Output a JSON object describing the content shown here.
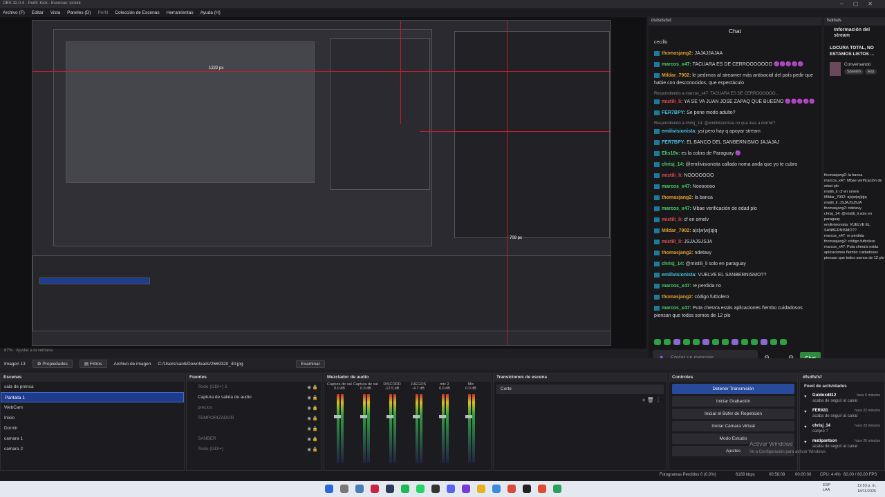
{
  "window": {
    "title": "OBS 32.0.4 - Perfil: Kick - Escenas: sickkk"
  },
  "menu": [
    "Archivo (F)",
    "Editar",
    "Vista",
    "Paneles (D)",
    "Perfil",
    "Colección de Escenas",
    "Herramientas",
    "Ayuda (H)"
  ],
  "preview": {
    "zoom": "87%",
    "fit": "Ajustar a la ventana",
    "px_label_1": "1222 px",
    "px_label_2": "709 px"
  },
  "chat": {
    "dock_title": "dsdsdsdsd",
    "title": "Chat",
    "messages": [
      {
        "user": "",
        "text": "cecillo"
      },
      {
        "user": "thomasjang2:",
        "text": "JAJAJJAJAA"
      },
      {
        "user": "marcos_x47:",
        "text": "TACUARA ES DE CERROOOOOOO 🟣🟣🟣🟣🟣"
      },
      {
        "user": "Mildar_7902:",
        "text": "le pedimos al streamer más antisocial del país pedir que habie con desconocidos, que espectáculo"
      },
      {
        "user": "mistili_li:",
        "text": "YA SE VA JUAN JOSE ZAPAQ QUE BUEENO 🟣🟣🟣🟣🟣",
        "reply": "Respondiendo a marcos_x47: TACUARA ES DE CERROOOOOO..."
      },
      {
        "user": "FER7BPY:",
        "text": "Se pone modo adulto?"
      },
      {
        "user": "emilivisionista:",
        "text": "ysi pero hay q apoyar stream",
        "reply": "Respondiendo a chrisj_14: @emilivisionista no qua loas a dormir?"
      },
      {
        "user": "FER7BPY:",
        "text": "EL BANCO DEL SANBERNISMO JAJAJAJ"
      },
      {
        "user": "Elis18v:",
        "text": "es la cobra de Paraguay 🟣"
      },
      {
        "user": "chrisj_14:",
        "text": "@emilivisionista callado noma anda que yo te cubro"
      },
      {
        "user": "mistili_li:",
        "text": "NOOOOOOO"
      },
      {
        "user": "marcos_x47:",
        "text": "Nooooooo"
      },
      {
        "user": "thomasjang2:",
        "text": "la banca"
      },
      {
        "user": "marcos_x47:",
        "text": "Mbae verificación de edad plo"
      },
      {
        "user": "mistili_li:",
        "text": "cf en omelv"
      },
      {
        "user": "Mildar_7902:",
        "text": "a|s|w|wj|q|q"
      },
      {
        "user": "mistili_li:",
        "text": "JSJAJSJSJA"
      },
      {
        "user": "thomasjang2:",
        "text": "ndetavy"
      },
      {
        "user": "chrisj_14:",
        "text": "@mistili_li solo en paraguay"
      },
      {
        "user": "emilivisionista:",
        "text": "VUELVE EL SANBERNISMO??"
      },
      {
        "user": "marcos_x47:",
        "text": "re perdida no"
      },
      {
        "user": "thomasjang2:",
        "text": "código futbolero"
      },
      {
        "user": "marcos_x47:",
        "text": "Puta chera'a estás aplicaciones ñembo cuidadosos piensan que todos somos de 12 plo"
      }
    ],
    "input_placeholder": "Enviar un mensaje",
    "send_label": "Chat"
  },
  "info": {
    "dock_title": "fsddsds",
    "title": "Información del stream",
    "stream_title": "LOCURA TOTAL, NO ESTAMOS LISTOS ...",
    "category": "Conversando",
    "tags": [
      "Spanish",
      "Exp"
    ],
    "mini_chat": [
      "thomasjang2: la banca",
      "marcos_x47: Mbae verificación de edad plo",
      "mistili_li: cf en omelv",
      "Mildar_7902: a|s|w|wj|q|q",
      "mistili_li: JSJAJSJSJA",
      "thomasjang2: ndetavy",
      "chrisj_14: @mistili_li solo en paraguay",
      "emilivisionista: VUELVE EL SANBERNISMO??",
      "marcos_x47: re perdida",
      "thomasjang2: código futbolero",
      "marcos_x47: Puta chera'a estás aplicaciones ñembo cuidadosos piensan que todos somos de 12 plo"
    ]
  },
  "source_bar": {
    "name": "Imagen 13",
    "props": "Propiedades",
    "filters": "Filtros",
    "file_label": "Archivo de imagen",
    "path": "C:/Users/santi/Downloads/2669320_40.jpg",
    "browse": "Examinar"
  },
  "scenes": {
    "title": "Escenas",
    "items": [
      "sala de prensa",
      "Pantalla 1",
      "WebCam",
      "Inicio",
      "Dormir",
      "camara 1",
      "camara 2"
    ],
    "selected": 1
  },
  "sources": {
    "title": "Fuentes",
    "items": [
      {
        "label": "Texto (GDI+) 2",
        "style": "dim"
      },
      {
        "label": "Captura de salida de audio",
        "style": ""
      },
      {
        "label": "precios",
        "style": "dim"
      },
      {
        "label": "TEMPORIZADOR",
        "style": "dim"
      },
      {
        "label": "",
        "style": "red"
      },
      {
        "label": "SANBER",
        "style": "dim"
      },
      {
        "label": "Texto (GDI+)",
        "style": "dim"
      }
    ]
  },
  "mixer": {
    "title": "Mezclador de audio",
    "channels": [
      {
        "name": "Captura de salida d",
        "db": "0.0 dB"
      },
      {
        "name": "Captura de salida d",
        "db": "0.0 dB"
      },
      {
        "name": "DISCORD",
        "db": "-12.5 dB"
      },
      {
        "name": "JUEGOS",
        "db": "-4.7 dB"
      },
      {
        "name": "mic 2",
        "db": "0.0 dB"
      },
      {
        "name": "Mic",
        "db": "0.0 dB"
      }
    ]
  },
  "transitions": {
    "title": "Transiciones de escena",
    "selected": "Corte"
  },
  "controls": {
    "title": "Controles",
    "buttons": [
      "Detener Transmisión",
      "Iniciar Grabación",
      "Iniciar el Búfer de Repetición",
      "Iniciar Cámara Virtual",
      "Modo Estudio",
      "Ajustes"
    ]
  },
  "activity": {
    "dock_title": "dfsdfsfsf",
    "title": "Feed de actividades",
    "items": [
      {
        "user": "Guidoxd812",
        "time": "hace 5 minutos",
        "text": "acaba de seguir al canal"
      },
      {
        "user": "FERX81",
        "time": "hace 22 minutos",
        "text": "acaba de seguir al canal"
      },
      {
        "user": "chrisj_14",
        "time": "hace 23 minutos",
        "text": "canjeó ?"
      },
      {
        "user": "matipantson",
        "time": "hace 26 minutos",
        "text": "acaba de seguir al canal"
      }
    ]
  },
  "status": {
    "dropped": "Fotogramas Perdidos 0 (0.0%)",
    "kbps": "6169 kbps",
    "time1": "00:58:08",
    "time2": "00:00:00",
    "cpu": "CPU: 4.4%",
    "fps": "60.00 / 60.00 FPS"
  },
  "watermark": {
    "line1": "Activar Windows",
    "line2": "Ve a Configuración para activar Windows."
  },
  "clock": {
    "time": "12:53 p. m.",
    "date": "18/11/2025",
    "lang": "ESP LAA"
  }
}
